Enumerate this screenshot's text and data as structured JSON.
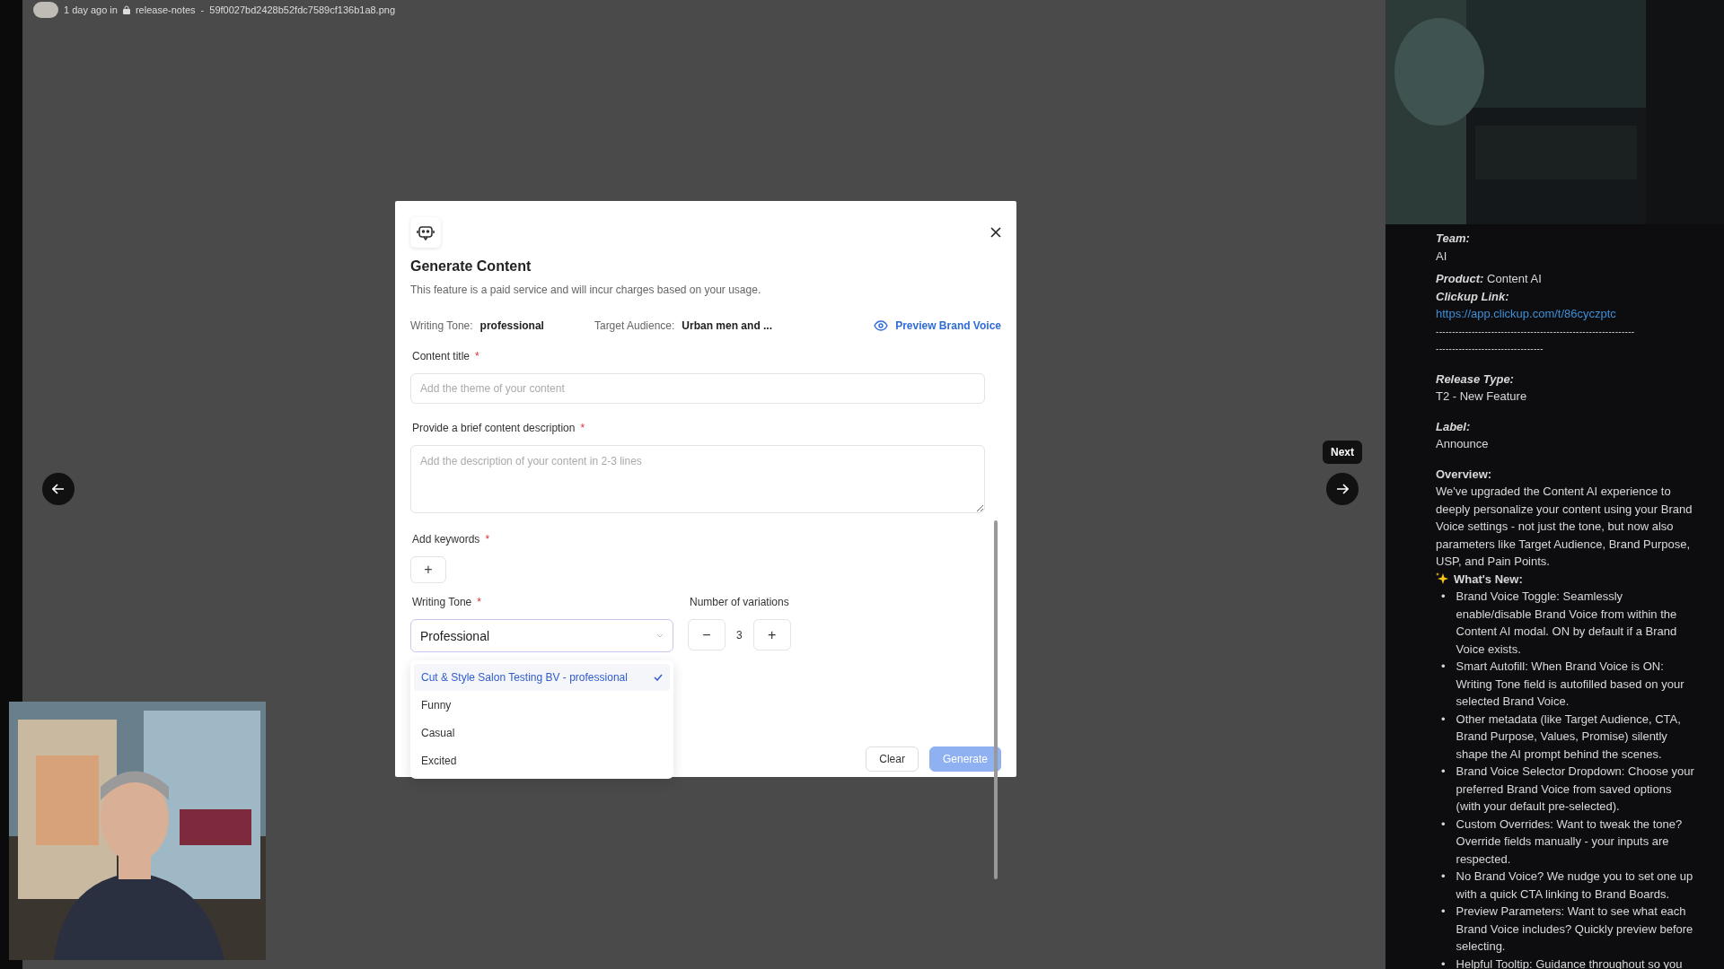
{
  "top_bar": {
    "time": "1 day ago in",
    "channel": "release-notes",
    "separator": "-",
    "filename": "59f0027bd2428b52fdc7589cf136b1a8.png"
  },
  "viewer": {
    "next_tooltip": "Next"
  },
  "modal": {
    "title": "Generate Content",
    "subtitle": "This feature is a paid service and will incur charges based on your usage.",
    "meta": [
      {
        "label": "Writing Tone:",
        "value": "professional"
      },
      {
        "label": "Target Audience:",
        "value": "Urban men and ..."
      }
    ],
    "preview_link": "Preview Brand Voice",
    "content_title": {
      "label": "Content title",
      "required_mark": "*",
      "placeholder": "Add the theme of your content"
    },
    "description": {
      "label": "Provide a brief content description",
      "required_mark": "*",
      "placeholder": "Add the description of your content in 2-3 lines"
    },
    "keywords": {
      "label": "Add keywords",
      "required_mark": "*",
      "add": "+"
    },
    "writing_tone": {
      "label": "Writing Tone",
      "required_mark": "*",
      "value": "Professional",
      "expanded": true,
      "options": [
        {
          "label": "Cut & Style Salon Testing BV - professional",
          "selected": true
        },
        {
          "label": "Funny",
          "selected": false
        },
        {
          "label": "Casual",
          "selected": false
        },
        {
          "label": "Excited",
          "selected": false
        }
      ]
    },
    "variations": {
      "label": "Number of variations",
      "minus": "−",
      "value": "3",
      "plus": "+"
    },
    "buttons": [
      {
        "label": "Clear",
        "kind": "secondary"
      },
      {
        "label": "Generate",
        "kind": "primary"
      }
    ]
  },
  "notes": {
    "team": {
      "label": "Team:",
      "value": "AI"
    },
    "product": {
      "label": "Product:",
      "value": "Content AI"
    },
    "link_label": "Clickup Link:",
    "link": "https://app.clickup.com/t/86cyczptc",
    "dashes": [
      "-------------------------------------------------------------",
      "---------------------------------"
    ],
    "fields2": [
      {
        "label": "Release Type:",
        "value": "T2 - New Feature"
      },
      {
        "label": "Label:",
        "value": "Announce"
      }
    ],
    "overview_label": "Overview:",
    "overview": "We've upgraded the Content AI experience to deeply personalize your content using your Brand Voice settings - not just the tone, but now also parameters like Target Audience, Brand Purpose, USP, and Pain Points.",
    "whats_new": "What's New:",
    "bullets": [
      {
        "marker": "•",
        "text": "Brand Voice Toggle: Seamlessly enable/disable Brand Voice from within the Content AI modal. ON by default if a Brand Voice exists."
      },
      {
        "marker": "•",
        "text": "Smart Autofill: When Brand Voice is ON: Writing Tone field is autofilled based on your selected Brand Voice."
      },
      {
        "marker": "•",
        "text": "Other metadata (like Target Audience, CTA, Brand Purpose, Values, Promise) silently shape the AI prompt behind the scenes."
      },
      {
        "marker": "•",
        "text": "Brand Voice Selector Dropdown: Choose your preferred Brand Voice from saved options (with your default pre-selected)."
      },
      {
        "marker": "•",
        "text": "Custom Overrides: Want to tweak the tone? Override fields manually - your inputs are respected."
      },
      {
        "marker": "•",
        "text": "No Brand Voice? We nudge you to set one up with a quick CTA linking to Brand Boards."
      },
      {
        "marker": "•",
        "text": "Preview Parameters: Want to see what each Brand Voice includes? Quickly preview before selecting."
      },
      {
        "marker": "•",
        "text": "Helpful Tooltip: Guidance throughout so you"
      }
    ]
  }
}
